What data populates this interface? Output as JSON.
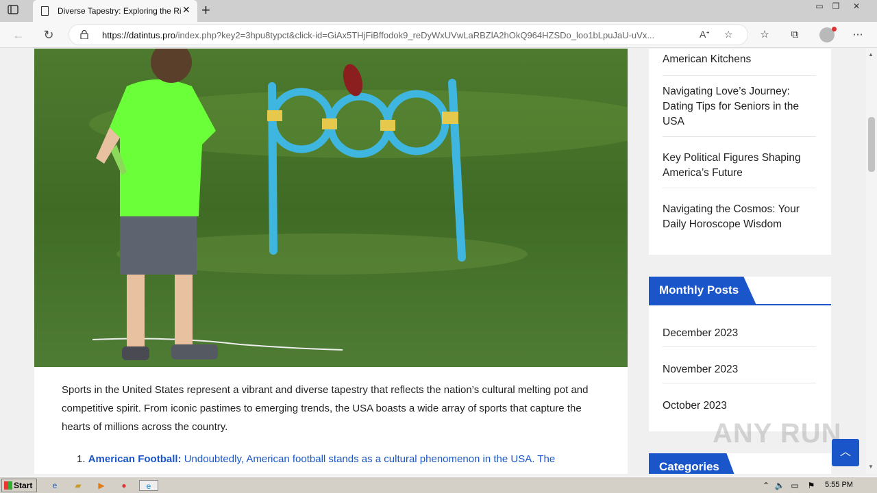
{
  "browser": {
    "tab_title": "Diverse Tapestry: Exploring the Ri",
    "url_host": "https://datintus.pro",
    "url_rest": "/index.php?key2=3hpu8typct&click-id=GiAx5THjFiBffodok9_reDyWxUVwLaRBZlA2hOkQ964HZSDo_loo1bLpuJaU-uVx..."
  },
  "article": {
    "intro": "Sports in the United States represent a vibrant and diverse tapestry that reflects the nation’s cultural melting pot and competitive spirit. From iconic pastimes to emerging trends, the USA boasts a wide array of sports that capture the hearts of millions across the country.",
    "item1_num": "1.",
    "item1_title": "American Football:",
    "item1_text": " Undoubtedly, American football stands as a cultural phenomenon in the USA. The"
  },
  "sidebar": {
    "recent": [
      "American Kitchens",
      "Navigating Love’s Journey: Dating Tips for Seniors in the USA",
      "Key Political Figures Shaping America’s Future",
      "Navigating the Cosmos: Your Daily Horoscope Wisdom"
    ],
    "monthly_title": "Monthly Posts",
    "months": [
      "December 2023",
      "November 2023",
      "October 2023"
    ],
    "categories_title": "Categories"
  },
  "watermark": "ANY RUN",
  "taskbar": {
    "start": "Start",
    "time": "5:55 PM"
  },
  "colors": {
    "accent": "#1a56c9"
  }
}
